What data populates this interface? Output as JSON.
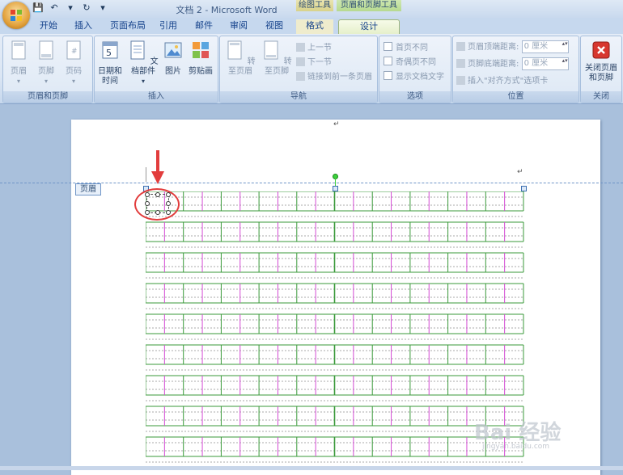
{
  "window": {
    "title": "文档 2 - Microsoft Word"
  },
  "context_groups": {
    "drawing_tools": "绘图工具",
    "header_footer_tools": "页眉和页脚工具"
  },
  "tabs": [
    {
      "label": "开始"
    },
    {
      "label": "插入"
    },
    {
      "label": "页面布局"
    },
    {
      "label": "引用"
    },
    {
      "label": "邮件"
    },
    {
      "label": "审阅"
    },
    {
      "label": "视图"
    },
    {
      "label": "格式"
    },
    {
      "label": "设计"
    }
  ],
  "ribbon": {
    "header_footer_group": {
      "label": "页眉和页脚",
      "header": "页眉",
      "footer": "页脚",
      "page_number": "页码"
    },
    "insert_group": {
      "label": "插入",
      "datetime": "日期和\n时间",
      "docparts": "文档部件",
      "picture": "图片",
      "clipart": "剪贴画"
    },
    "nav_group": {
      "label": "导航",
      "goto_header": "转至页眉",
      "goto_footer": "转至页脚",
      "prev": "上一节",
      "next": "下一节",
      "link_prev": "链接到前一条页眉"
    },
    "options_group": {
      "label": "选项",
      "diff_first": "首页不同",
      "diff_odd_even": "奇偶页不同",
      "show_text": "显示文档文字"
    },
    "position_group": {
      "label": "位置",
      "header_top": "页眉顶端距离:",
      "footer_bottom": "页脚底端距离:",
      "header_top_value": "0 厘米",
      "footer_bottom_value": "0 厘米",
      "insert_align": "插入\"对齐方式\"选项卡"
    },
    "close_group": {
      "label": "关闭",
      "close_btn": "关闭页眉\n和页脚"
    }
  },
  "document": {
    "header_tag": "页眉"
  },
  "watermark": {
    "brand": "Bai 经验",
    "url": "jingyan.baidu.com"
  },
  "colors": {
    "grid_green": "#3a9a3a",
    "grid_magenta": "#d44ad4",
    "highlight_red": "#e23d3d"
  },
  "icons": [
    "office-button-icon",
    "save-icon",
    "undo-icon",
    "redo-icon",
    "customize-qat-icon",
    "close-red-x-icon"
  ]
}
